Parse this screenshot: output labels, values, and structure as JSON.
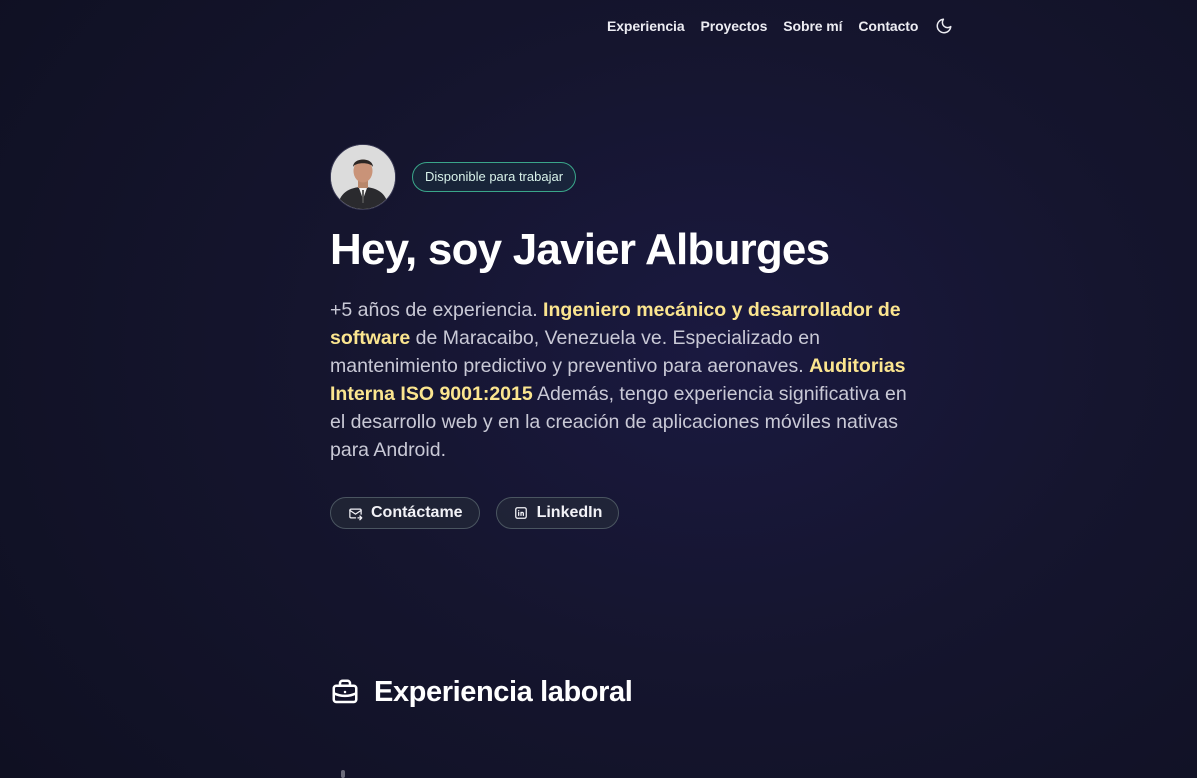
{
  "nav": {
    "items": [
      {
        "label": "Experiencia"
      },
      {
        "label": "Proyectos"
      },
      {
        "label": "Sobre mí"
      },
      {
        "label": "Contacto"
      }
    ],
    "theme_icon": "moon-icon"
  },
  "hero": {
    "badge": "Disponible para trabajar",
    "title": "Hey, soy Javier Alburges",
    "intro": {
      "p1": "+5 años de experiencia. ",
      "h1": "Ingeniero mecánico y desarrollador de software",
      "p2": " de Maracaibo, Venezuela ve. Especializado en mantenimiento predictivo y preventivo para aeronaves. ",
      "h2": "Auditorias Interna ISO 9001:2015",
      "p3": " Además, tengo experiencia significativa en el desarrollo web y en la creación de aplicaciones móviles nativas para Android."
    },
    "buttons": {
      "contact": {
        "label": "Contáctame",
        "icon": "mail-icon"
      },
      "linkedin": {
        "label": "LinkedIn",
        "icon": "linkedin-icon"
      }
    }
  },
  "section": {
    "title": "Experiencia laboral",
    "icon": "briefcase-icon"
  },
  "colors": {
    "highlight": "#fbe58f",
    "badge_border": "#3aa68a",
    "background": "#15152e"
  }
}
